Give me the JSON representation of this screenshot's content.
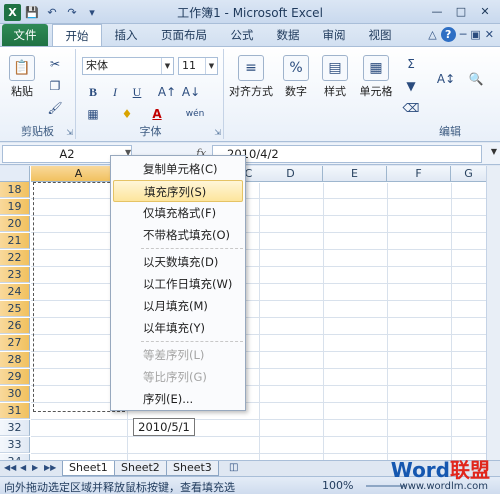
{
  "window": {
    "title": "工作簿1 - Microsoft Excel"
  },
  "ribbon_tabs": [
    "文件",
    "开始",
    "插入",
    "页面布局",
    "公式",
    "数据",
    "审阅",
    "视图"
  ],
  "ribbon": {
    "paste_label": "粘贴",
    "clipboard_group": "剪贴板",
    "font_name": "宋体",
    "font_size": "11",
    "font_group": "字体",
    "align_label": "对齐方式",
    "number_label": "数字",
    "styles_label": "样式",
    "cells_label": "单元格",
    "editing_group": "编辑",
    "bold": "B",
    "italic": "I",
    "underline": "U",
    "font_color": "A",
    "number_icon": "%"
  },
  "formula_bar": {
    "name_box": "A2",
    "fx": "fx",
    "value": "2010/4/2"
  },
  "grid": {
    "columns": [
      "A",
      "B",
      "C",
      "D",
      "E",
      "F",
      "G"
    ],
    "rows": [
      "18",
      "19",
      "20",
      "21",
      "22",
      "23",
      "24",
      "25",
      "26",
      "27",
      "28",
      "29",
      "30",
      "31",
      "32",
      "33",
      "34"
    ]
  },
  "context_menu": {
    "items": [
      {
        "label": "复制单元格(C)",
        "disabled": false
      },
      {
        "label": "填充序列(S)",
        "disabled": false,
        "highlighted": true
      },
      {
        "label": "仅填充格式(F)",
        "disabled": false
      },
      {
        "label": "不带格式填充(O)",
        "disabled": false
      },
      {
        "label": "以天数填充(D)",
        "disabled": false
      },
      {
        "label": "以工作日填充(W)",
        "disabled": false
      },
      {
        "label": "以月填充(M)",
        "disabled": false
      },
      {
        "label": "以年填充(Y)",
        "disabled": false
      },
      {
        "label": "等差序列(L)",
        "disabled": true
      },
      {
        "label": "等比序列(G)",
        "disabled": true
      },
      {
        "label": "序列(E)...",
        "disabled": false
      }
    ]
  },
  "fill_tooltip": "2010/5/1",
  "sheets": [
    "Sheet1",
    "Sheet2",
    "Sheet3"
  ],
  "status": {
    "message": "向外拖动选定区域并释放鼠标按键，查看填充选",
    "zoom": "100%"
  },
  "watermark": {
    "logo_a": "Word",
    "logo_b": "联盟",
    "url": "www.wordlm.com"
  },
  "colors": {
    "file_tab": "#1f7244",
    "selected_header": "#f1c15f",
    "menu_highlight": "#fde59c"
  }
}
